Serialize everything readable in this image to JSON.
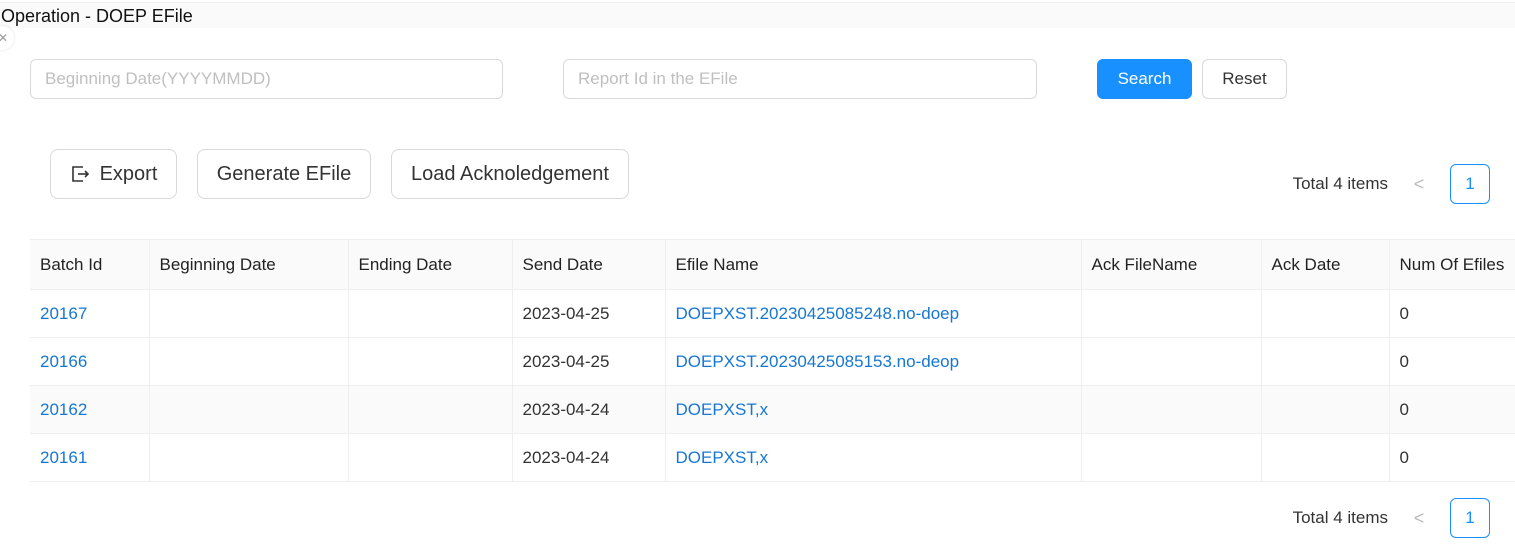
{
  "app": {
    "title": "Operation - DOEP EFile"
  },
  "search": {
    "date_placeholder": "Beginning Date(YYYYMMDD)",
    "report_placeholder": "Report Id in the EFile",
    "search_label": "Search",
    "reset_label": "Reset"
  },
  "toolbar": {
    "export_label": "Export",
    "generate_label": "Generate EFile",
    "load_label": "Load Acknoledgement"
  },
  "pagination": {
    "total_text": "Total 4 items",
    "current_page": "1"
  },
  "table": {
    "columns": [
      "Batch Id",
      "Beginning Date",
      "Ending Date",
      "Send Date",
      "Efile Name",
      "Ack FileName",
      "Ack Date",
      "Num Of Efiles"
    ],
    "rows": [
      {
        "batch_id": "20167",
        "beginning_date": "",
        "ending_date": "",
        "send_date": "2023-04-25",
        "efile_name": "DOEPXST.20230425085248.no-doep",
        "ack_filename": "",
        "ack_date": "",
        "num_efiles": "0"
      },
      {
        "batch_id": "20166",
        "beginning_date": "",
        "ending_date": "",
        "send_date": "2023-04-25",
        "efile_name": "DOEPXST.20230425085153.no-deop",
        "ack_filename": "",
        "ack_date": "",
        "num_efiles": "0"
      },
      {
        "batch_id": "20162",
        "beginning_date": "",
        "ending_date": "",
        "send_date": "2023-04-24",
        "efile_name": "DOEPXST,x",
        "ack_filename": "",
        "ack_date": "",
        "num_efiles": "0"
      },
      {
        "batch_id": "20161",
        "beginning_date": "",
        "ending_date": "",
        "send_date": "2023-04-24",
        "efile_name": "DOEPXST,x",
        "ack_filename": "",
        "ack_date": "",
        "num_efiles": "0"
      }
    ]
  },
  "colors": {
    "primary": "#1890ff",
    "link": "#1677d2",
    "border": "#d9d9d9"
  }
}
